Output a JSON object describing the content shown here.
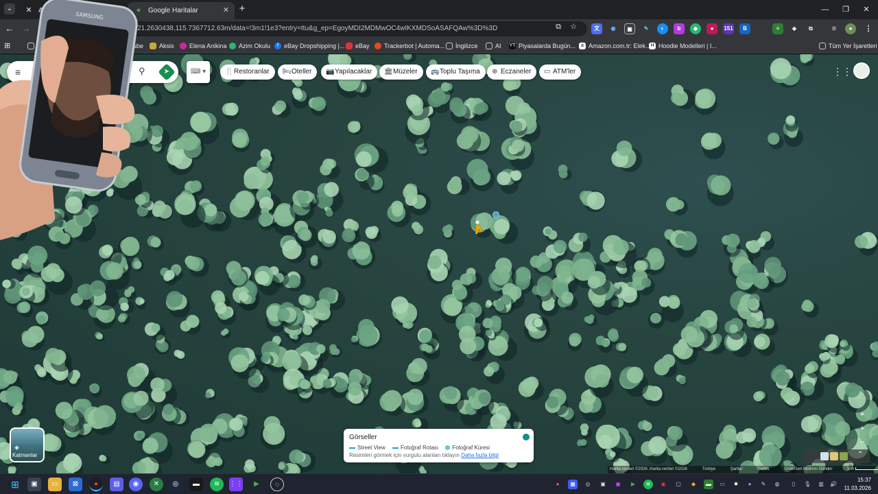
{
  "browser": {
    "tabs": [
      {
        "title": "Anasay",
        "icon": "x-icon"
      },
      {
        "title": "Google Haritalar",
        "icon": "google-maps-icon"
      }
    ],
    "new_tab_label": "+",
    "url": "21.2630438,115.7367712.63m/data=!3m1!1e3?entry=ttu&g_ep=EgoyMDI2MDMwOC4wIKXMDSoASAFQAw%3D%3D",
    "bookmarks": [
      {
        "label": "ube",
        "icon": "youtube-icon"
      },
      {
        "label": "Aksis",
        "icon": "aksis-icon"
      },
      {
        "label": "Elena Anikina",
        "icon": "instagram-icon"
      },
      {
        "label": "Azim Okulu",
        "icon": "azim-icon"
      },
      {
        "label": "eBay Dropshipping |...",
        "icon": "facebook-icon"
      },
      {
        "label": "eBay",
        "icon": "ebay-icon"
      },
      {
        "label": "Trackerbot | Automa...",
        "icon": "trackerbot-icon"
      },
      {
        "label": "İngilizce",
        "icon": "folder-icon"
      },
      {
        "label": "AI",
        "icon": "folder-icon"
      },
      {
        "label": "Piyasalarda Bugün...",
        "icon": "yt-icon"
      },
      {
        "label": "Amazon.com.tr: Elek...",
        "icon": "amazon-icon"
      },
      {
        "label": "Hoodie Modelleri | I...",
        "icon": "hoodie-icon"
      }
    ],
    "all_bookmarks_label": "Tüm Yer İşaretleri"
  },
  "maps": {
    "search_placeholder": "",
    "chips": [
      {
        "label": "Restoranlar",
        "icon": "fork-knife-icon"
      },
      {
        "label": "Oteller",
        "icon": "bed-icon"
      },
      {
        "label": "Yapılacaklar",
        "icon": "camera-icon"
      },
      {
        "label": "Müzeler",
        "icon": "museum-icon"
      },
      {
        "label": "Toplu Taşıma",
        "icon": "bus-icon"
      },
      {
        "label": "Eczaneler",
        "icon": "pharmacy-icon"
      },
      {
        "label": "ATM'ler",
        "icon": "atm-icon"
      }
    ],
    "layers_label": "Katmanlar",
    "gorseller": {
      "title": "Görseller",
      "legend": [
        "Street View",
        "Fotoğraf Rotası",
        "Fotoğraf Küresi"
      ],
      "hint": "Resimleri görmek için vurgulu alanları tıklayın",
      "link": "Daha fazla bilgi"
    },
    "attribution": [
      "Harita verileri ©2026 ,Harita verileri ©2026",
      "Türkiye",
      "Şartlar",
      "Gizlilik",
      "Ürün Geri Bildirimi Gönder",
      "5 m"
    ]
  },
  "taskbar": {
    "time": "15:37",
    "date": "11.03.2026"
  }
}
